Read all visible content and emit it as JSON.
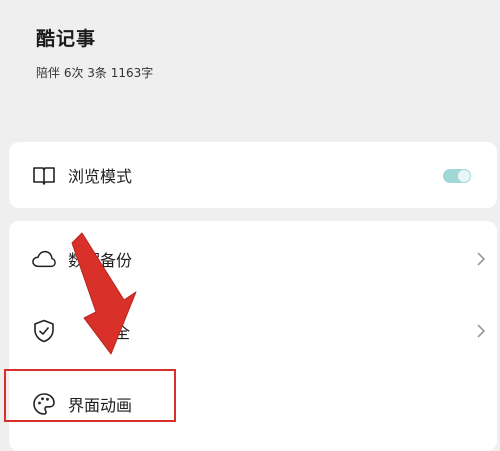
{
  "header": {
    "title": "酷记事",
    "subtitle": "陪伴 6次 3条 1163字"
  },
  "settings_top": {
    "items": [
      {
        "label": "浏览模式",
        "icon": "book-icon",
        "toggle_on": true
      }
    ]
  },
  "settings_main": {
    "items": [
      {
        "label": "数据备份",
        "icon": "cloud-icon"
      },
      {
        "label": "隐私安全",
        "visible_part": "安全",
        "icon": "shield-icon"
      },
      {
        "label": "界面动画",
        "icon": "palette-icon"
      }
    ]
  },
  "colors": {
    "background": "#efefef",
    "card": "#ffffff",
    "toggle_accent": "#9fd8d4",
    "annotation_red": "#d9302a"
  }
}
